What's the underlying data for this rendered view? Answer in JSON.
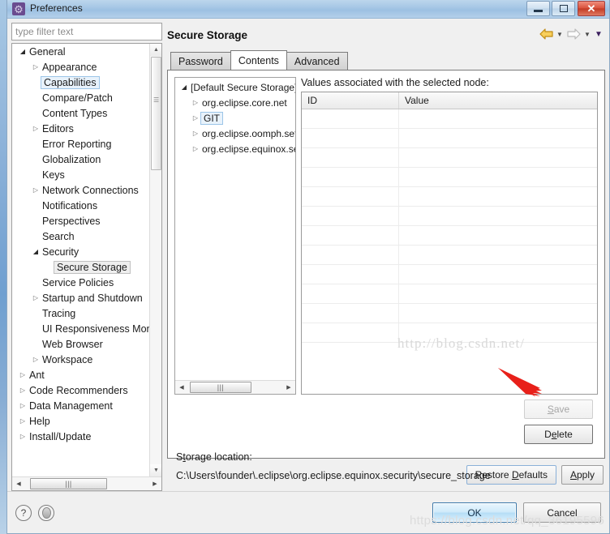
{
  "window": {
    "title": "Preferences",
    "icon": "gear-icon",
    "minimize_label": "Minimize",
    "maximize_label": "Maximize",
    "close_label": "Close"
  },
  "filter": {
    "placeholder": "type filter text",
    "value": ""
  },
  "sidebar": {
    "items": [
      {
        "label": "General",
        "indent": 0,
        "arrow": "open",
        "state": "normal"
      },
      {
        "label": "Appearance",
        "indent": 1,
        "arrow": "closed",
        "state": "normal"
      },
      {
        "label": "Capabilities",
        "indent": 1,
        "arrow": "none",
        "state": "sel-focus"
      },
      {
        "label": "Compare/Patch",
        "indent": 1,
        "arrow": "none",
        "state": "normal"
      },
      {
        "label": "Content Types",
        "indent": 1,
        "arrow": "none",
        "state": "normal"
      },
      {
        "label": "Editors",
        "indent": 1,
        "arrow": "closed",
        "state": "normal"
      },
      {
        "label": "Error Reporting",
        "indent": 1,
        "arrow": "none",
        "state": "normal"
      },
      {
        "label": "Globalization",
        "indent": 1,
        "arrow": "none",
        "state": "normal"
      },
      {
        "label": "Keys",
        "indent": 1,
        "arrow": "none",
        "state": "normal"
      },
      {
        "label": "Network Connections",
        "indent": 1,
        "arrow": "closed",
        "state": "normal"
      },
      {
        "label": "Notifications",
        "indent": 1,
        "arrow": "none",
        "state": "normal"
      },
      {
        "label": "Perspectives",
        "indent": 1,
        "arrow": "none",
        "state": "normal"
      },
      {
        "label": "Search",
        "indent": 1,
        "arrow": "none",
        "state": "normal"
      },
      {
        "label": "Security",
        "indent": 1,
        "arrow": "open",
        "state": "normal"
      },
      {
        "label": "Secure Storage",
        "indent": 2,
        "arrow": "none",
        "state": "sel-plain"
      },
      {
        "label": "Service Policies",
        "indent": 1,
        "arrow": "none",
        "state": "normal"
      },
      {
        "label": "Startup and Shutdown",
        "indent": 1,
        "arrow": "closed",
        "state": "normal"
      },
      {
        "label": "Tracing",
        "indent": 1,
        "arrow": "none",
        "state": "normal"
      },
      {
        "label": "UI Responsiveness Monitoring",
        "indent": 1,
        "arrow": "none",
        "state": "normal"
      },
      {
        "label": "Web Browser",
        "indent": 1,
        "arrow": "none",
        "state": "normal"
      },
      {
        "label": "Workspace",
        "indent": 1,
        "arrow": "closed",
        "state": "normal"
      },
      {
        "label": "Ant",
        "indent": 0,
        "arrow": "closed",
        "state": "normal"
      },
      {
        "label": "Code Recommenders",
        "indent": 0,
        "arrow": "closed",
        "state": "normal"
      },
      {
        "label": "Data Management",
        "indent": 0,
        "arrow": "closed",
        "state": "normal"
      },
      {
        "label": "Help",
        "indent": 0,
        "arrow": "closed",
        "state": "normal"
      },
      {
        "label": "Install/Update",
        "indent": 0,
        "arrow": "closed",
        "state": "normal"
      }
    ]
  },
  "page": {
    "title": "Secure Storage",
    "nav": {
      "back_icon": "back-arrow-icon",
      "back_menu_icon": "chevron-down-icon",
      "forward_icon": "forward-arrow-icon",
      "forward_menu_icon": "chevron-down-icon",
      "view_menu_icon": "chevron-down-icon"
    }
  },
  "tabs": [
    {
      "label": "Password",
      "active": false
    },
    {
      "label": "Contents",
      "active": true
    },
    {
      "label": "Advanced",
      "active": false
    }
  ],
  "contents_tab": {
    "node_tree": [
      {
        "label": "[Default Secure Storage]",
        "indent": 0,
        "arrow": "open",
        "state": "normal"
      },
      {
        "label": "org.eclipse.core.net",
        "indent": 1,
        "arrow": "closed",
        "state": "normal"
      },
      {
        "label": "GIT",
        "indent": 1,
        "arrow": "closed",
        "state": "sel-focus"
      },
      {
        "label": "org.eclipse.oomph.setup",
        "indent": 1,
        "arrow": "closed",
        "state": "normal"
      },
      {
        "label": "org.eclipse.equinox.secures",
        "indent": 1,
        "arrow": "closed",
        "state": "normal"
      }
    ],
    "values_label": "Values associated with the selected node:",
    "table": {
      "columns": [
        "ID",
        "Value"
      ],
      "rows": [],
      "empty_row_count": 12
    },
    "buttons": {
      "save": {
        "label": "Save",
        "mnemonic": "S",
        "enabled": false
      },
      "delete": {
        "label": "Delete",
        "mnemonic": "l",
        "enabled": true
      }
    },
    "storage_location": {
      "label": "Storage location:",
      "mnemonic": "t",
      "path": "C:\\Users\\founder\\.eclipse\\org.eclipse.equinox.security\\secure_storage"
    }
  },
  "page_buttons": {
    "restore_defaults": "Restore Defaults",
    "apply": "Apply"
  },
  "footer": {
    "help_icon": "question-mark-icon",
    "shell_icon": "shell-status-icon",
    "ok": "OK",
    "cancel": "Cancel"
  },
  "annotations": {
    "red_arrow_target": "delete-button",
    "red_arrow_color": "#e8201a"
  },
  "watermarks": {
    "center": "http://blog.csdn.net/",
    "bottom": "https://blog.csdn.net/qq_36195596"
  }
}
